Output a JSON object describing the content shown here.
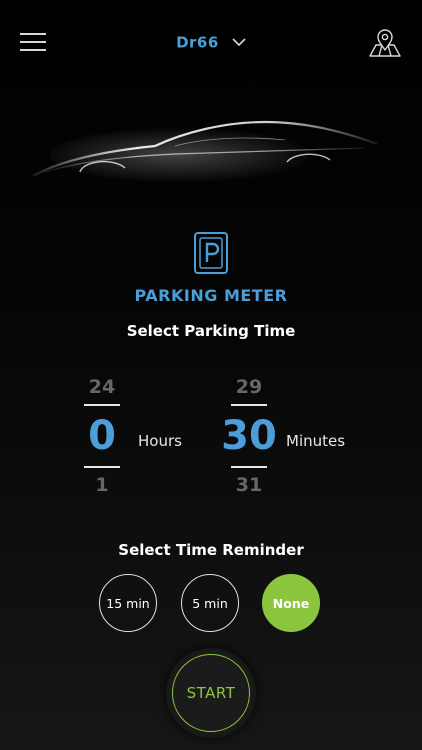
{
  "header": {
    "vehicle_name": "Dr66",
    "menu_icon": "hamburger-menu-icon",
    "map_icon": "map-pin-icon",
    "dropdown_icon": "chevron-down-icon"
  },
  "parking": {
    "icon": "parking-sign-icon",
    "title": "PARKING METER",
    "subtitle": "Select Parking Time"
  },
  "time_picker": {
    "hours": {
      "prev": "24",
      "value": "0",
      "next": "1",
      "label": "Hours"
    },
    "minutes": {
      "prev": "29",
      "value": "30",
      "next": "31",
      "label": "Minutes"
    }
  },
  "reminder": {
    "title": "Select Time Reminder",
    "options": [
      "15 min",
      "5 min",
      "None"
    ],
    "selected": "None"
  },
  "start_label": "START",
  "colors": {
    "accent_blue": "#4c9ed9",
    "accent_green": "#8cc63f",
    "background": "#000000"
  }
}
